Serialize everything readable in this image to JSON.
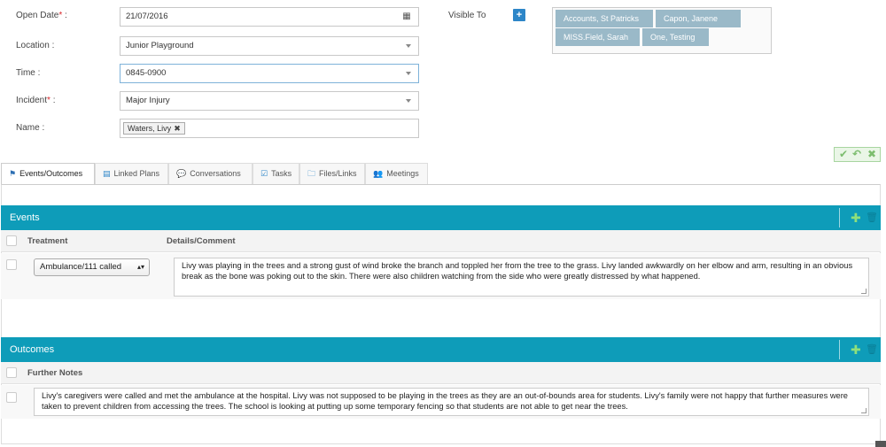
{
  "form": {
    "open_date_label": "Open Date",
    "open_date_value": "21/07/2016",
    "location_label": "Location :",
    "location_value": "Junior Playground",
    "time_label": "Time :",
    "time_value": "0845-0900",
    "incident_label": "Incident",
    "incident_value": "Major Injury",
    "name_label": "Name :",
    "name_tag": "Waters, Livy",
    "required_mark": "*",
    "colon": " :"
  },
  "visible_to": {
    "label": "Visible To",
    "add_symbol": "+",
    "people": [
      "Accounts, St Patricks",
      "Capon, Janene",
      "MISS.Field, Sarah",
      "One, Testing"
    ]
  },
  "actions": {
    "save_icon": "✔",
    "undo_icon": "↶",
    "cancel_icon": "✖"
  },
  "tabs": [
    {
      "label": "Events/Outcomes",
      "icon": "flag-icon",
      "glyph": "⚑"
    },
    {
      "label": "Linked Plans",
      "icon": "list-icon",
      "glyph": "▤"
    },
    {
      "label": "Conversations",
      "icon": "chat-icon",
      "glyph": "💬"
    },
    {
      "label": "Tasks",
      "icon": "checkbox-icon",
      "glyph": "☑"
    },
    {
      "label": "Files/Links",
      "icon": "folder-icon",
      "glyph": "🗀"
    },
    {
      "label": "Meetings",
      "icon": "group-icon",
      "glyph": "👥"
    }
  ],
  "events": {
    "title": "Events",
    "col_treatment": "Treatment",
    "col_details": "Details/Comment",
    "row": {
      "treatment": "Ambulance/111 called",
      "details": "Livy was playing in the trees and a strong gust of wind broke the branch and toppled her from the tree to the grass.  Livy landed awkwardly on her elbow and arm, resulting in an obvious break as the bone was poking out to the skin.  There were also children watching from the side who were greatly distressed by what happened."
    }
  },
  "outcomes": {
    "title": "Outcomes",
    "col_notes": "Further Notes",
    "row": {
      "notes": "Livy's caregivers were called and met the ambulance at the hospital.  Livy was not supposed to be playing in the trees as they are an out-of-bounds area for students.  Livy's family were not happy that further measures were taken to prevent children from accessing the trees. The school is looking at putting up some temporary fencing so that students are not able to get near the trees."
    }
  },
  "section_icons": {
    "add": "✚",
    "delete": "🗑"
  },
  "colors": {
    "accent": "#0e9cb9",
    "pill": "#9ab9c8",
    "required": "#d9262b",
    "save_green": "#7cbd6e"
  }
}
